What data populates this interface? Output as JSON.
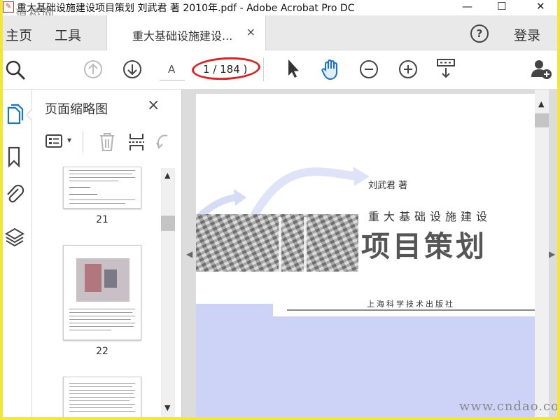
{
  "titlebar": {
    "logo": "✎",
    "title": "重大基础设施建设项目策划 刘武君 著 2010年.pdf - Adobe Acrobat Pro DC",
    "minimize": "—",
    "maximize": "☐",
    "close": "✕",
    "watermark": "道桥网"
  },
  "menu": {
    "home": "主页",
    "tools": "工具",
    "help": "?",
    "login": "登录"
  },
  "tab": {
    "label": "重大基础设施建设...",
    "close": "×"
  },
  "toolbar": {
    "page_prefix": "A",
    "page_counter": "1 / 184 )",
    "icons": [
      "search-icon",
      "prev-page-icon",
      "next-page-icon",
      "select-cursor-icon",
      "hand-tool-icon",
      "zoom-out-icon",
      "zoom-in-icon",
      "page-display-icon",
      "share-user-icon"
    ]
  },
  "leftrail": {
    "icons": [
      "pages-icon",
      "bookmark-icon",
      "attachment-icon",
      "layers-icon"
    ]
  },
  "panel": {
    "title": "页面缩略图",
    "close": "×",
    "options_arrow": "▾",
    "thumbnails": [
      {
        "label": "21"
      },
      {
        "label": "22"
      },
      {
        "label": ""
      }
    ]
  },
  "page": {
    "author": "刘武君  著",
    "series": "重大基础设施建设",
    "title": "项目策划",
    "publisher": "上海科学技术出版社"
  },
  "scroll": {
    "up": "▲",
    "down": "▼",
    "left": "◀",
    "right": "▶"
  },
  "watermark_bottom": "www.cndao.com",
  "colors": {
    "accent": "#1a73c8",
    "highlight": "#e02020",
    "cover_blue": "#cdd3f6"
  }
}
